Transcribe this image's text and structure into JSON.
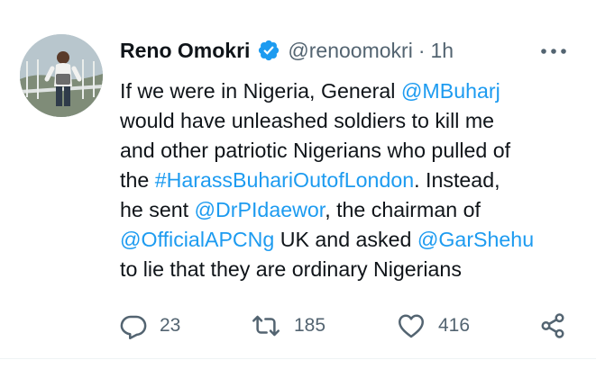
{
  "tweet": {
    "author_name": "Reno Omokri",
    "handle": "@renoomokri",
    "separator": "·",
    "time": "1h",
    "lines": [
      [
        {
          "t": "If we were in Nigeria, General ",
          "link": false
        },
        {
          "t": "@MBuharj",
          "link": true
        }
      ],
      [
        {
          "t": "would have unleashed soldiers to kill me",
          "link": false
        }
      ],
      [
        {
          "t": "and other patriotic Nigerians who pulled of",
          "link": false
        }
      ],
      [
        {
          "t": "the ",
          "link": false
        },
        {
          "t": "#HarassBuhariOutofLondon",
          "link": true
        },
        {
          "t": ". Instead,",
          "link": false
        }
      ],
      [
        {
          "t": "he sent ",
          "link": false
        },
        {
          "t": "@DrPIdaewor",
          "link": true
        },
        {
          "t": ", the chairman of",
          "link": false
        }
      ],
      [
        {
          "t": "@OfficialAPCNg",
          "link": true
        },
        {
          "t": " UK and asked ",
          "link": false
        },
        {
          "t": "@GarShehu",
          "link": true
        }
      ],
      [
        {
          "t": " to lie that they are ordinary Nigerians",
          "link": false
        }
      ]
    ],
    "replies": "23",
    "retweets": "185",
    "likes": "416"
  },
  "icons": {
    "verified": "verified-badge-icon",
    "more": "more-dots-icon",
    "reply": "reply-icon",
    "retweet": "retweet-icon",
    "like": "heart-icon",
    "share": "share-icon"
  },
  "colors": {
    "link": "#1d9bf0",
    "secondary_text": "#536471",
    "primary_text": "#0f1419",
    "divider": "#eff3f4"
  }
}
